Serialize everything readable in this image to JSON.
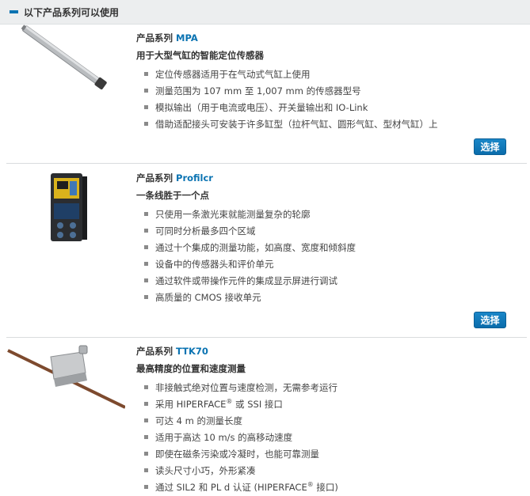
{
  "header": {
    "title": "以下产品系列可以使用"
  },
  "products": [
    {
      "series_prefix": "产品系列",
      "series_name": "MPA",
      "tagline": "用于大型气缸的智能定位传感器",
      "bullets": [
        "定位传感器适用于在气动式气缸上使用",
        "测量范围为 107 mm 至 1,007 mm 的传感器型号",
        "模拟输出（用于电流或电压）、开关量输出和 IO-Link",
        "借助适配接头可安装于许多缸型（拉杆气缸、圆形气缸、型材气缸）上"
      ],
      "button": "选择"
    },
    {
      "series_prefix": "产品系列",
      "series_name": "Profilcr",
      "tagline": "一条线胜于一个点",
      "bullets": [
        "只使用一条激光束就能测量复杂的轮廓",
        "可同时分析最多四个区域",
        "通过十个集成的测量功能，如高度、宽度和倾斜度",
        "设备中的传感器头和评价单元",
        "通过软件或带操作元件的集成显示屏进行调试",
        "高质量的 CMOS 接收单元"
      ],
      "button": "选择"
    },
    {
      "series_prefix": "产品系列",
      "series_name": "TTK70",
      "tagline": "最高精度的位置和速度测量",
      "bullets": [
        "非接触式绝对位置与速度检测，无需参考运行",
        "可达 4 m 的测量长度",
        "适用于高达 10 m/s 的高移动速度",
        "即使在磁条污染或冷凝时，也能可靠测量",
        "读头尺寸小巧，外形紧凑"
      ],
      "bullet_hiperface": {
        "before": "采用 HIPERFACE",
        "reg": "®",
        "after": " 或 SSI 接口"
      },
      "bullet_sil": {
        "before": "通过 SIL2 和 PL d 认证 (HIPERFACE",
        "reg": "®",
        "after": " 接口)"
      }
    }
  ]
}
